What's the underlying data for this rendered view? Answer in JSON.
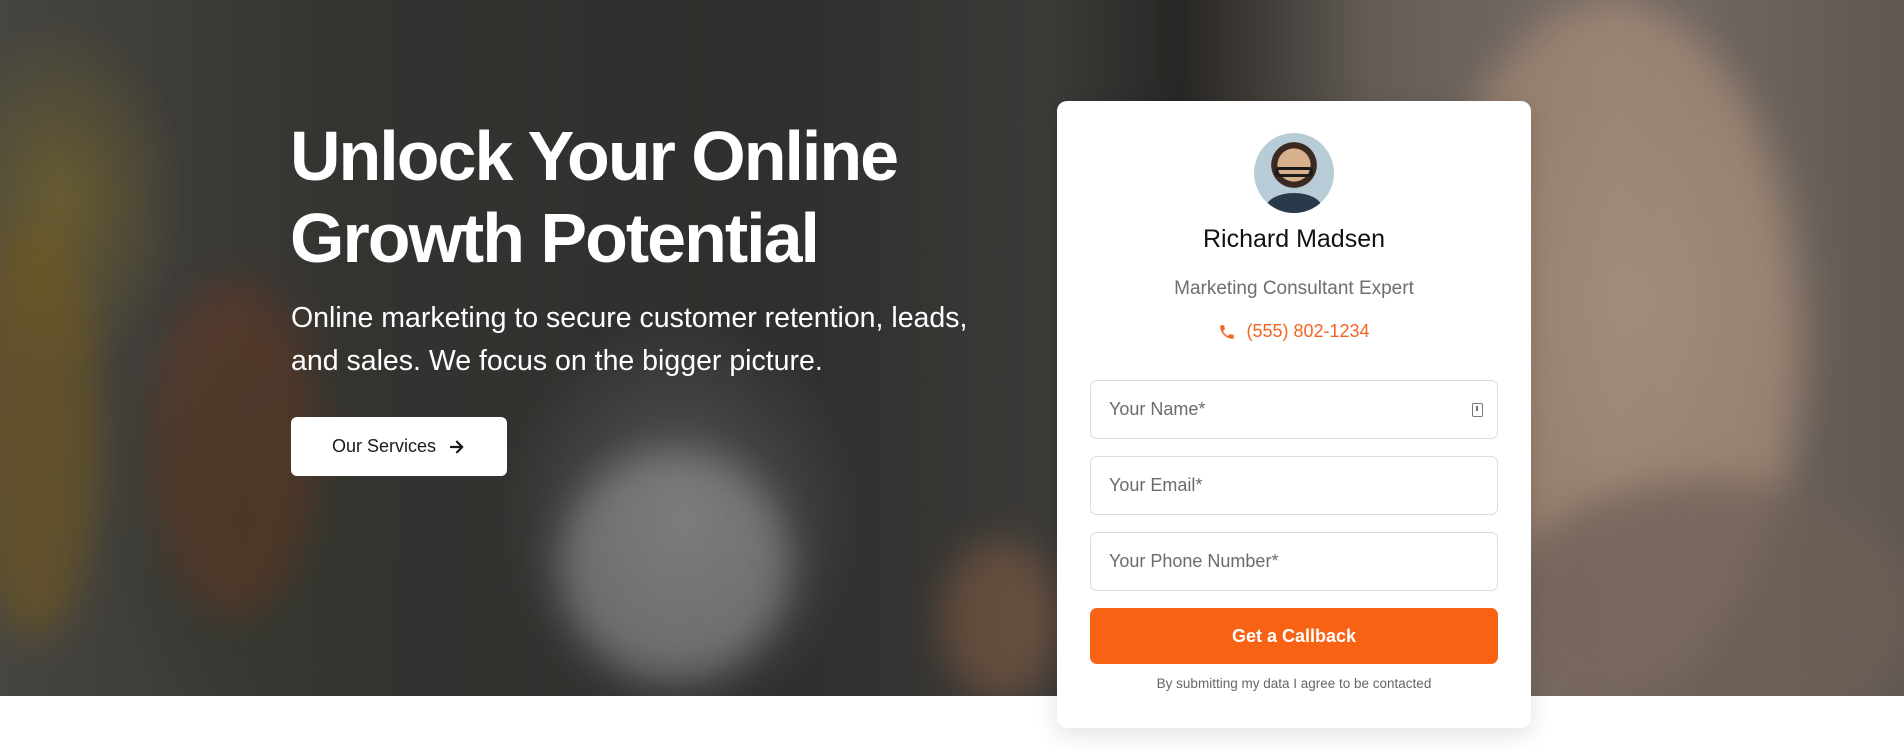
{
  "hero": {
    "title": "Unlock Your Online Growth Potential",
    "subtitle": "Online marketing to secure customer retention, leads, and sales. We focus on the bigger picture.",
    "cta_label": "Our Services",
    "cta_icon": "arrow-right-icon"
  },
  "contact_card": {
    "name": "Richard Madsen",
    "role": "Marketing Consultant Expert",
    "phone": "(555) 802-1234",
    "phone_icon": "phone-icon",
    "fields": [
      {
        "placeholder": "Your Name*",
        "value": ""
      },
      {
        "placeholder": "Your Email*",
        "value": ""
      },
      {
        "placeholder": "Your Phone Number*",
        "value": ""
      }
    ],
    "submit_label": "Get a Callback",
    "consent_text": "By submitting my data I agree to be contacted"
  },
  "colors": {
    "accent": "#f76215",
    "phone_text": "#f26522",
    "card_bg": "#ffffff",
    "hero_text": "#ffffff"
  }
}
